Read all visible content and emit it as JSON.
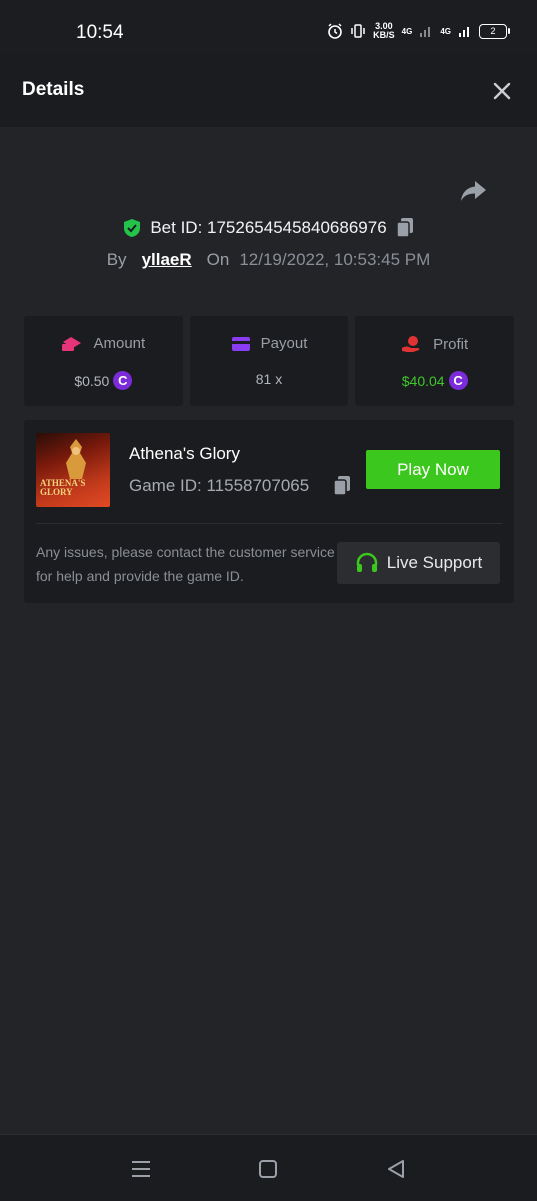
{
  "status_bar": {
    "time": "10:54",
    "speed_value": "3.00",
    "speed_unit": "KB/S",
    "network_1": "4G",
    "network_2": "4G",
    "battery": "2"
  },
  "header": {
    "title": "Details",
    "close_icon": "close-icon"
  },
  "bet": {
    "share_icon": "share-icon",
    "bet_id_label": "Bet ID: 1752654545840686976",
    "by_label": "By",
    "username": "yllaeR",
    "on_label": "On",
    "datetime": "12/19/2022, 10:53:45 PM"
  },
  "stats": {
    "amount": {
      "label": "Amount",
      "value": "$0.50",
      "coin": "C"
    },
    "payout": {
      "label": "Payout",
      "value": "81 x"
    },
    "profit": {
      "label": "Profit",
      "value": "$40.04",
      "coin": "C"
    }
  },
  "game": {
    "thumb_line1": "ATHENA'S",
    "thumb_line2": "GLORY",
    "name": "Athena's Glory",
    "game_id_label": "Game ID: 11558707065",
    "play_button": "Play Now",
    "help_text": "Any issues, please contact the customer service for help and provide the game ID.",
    "support_button": "Live Support"
  },
  "colors": {
    "accent_green": "#3cc71e",
    "profit_green": "#3fc72c",
    "coin_purple": "#7c2bd8",
    "amount_pink": "#e6347a",
    "payout_purple": "#8a3cf0",
    "profit_red": "#e03434",
    "background": "#232428"
  }
}
